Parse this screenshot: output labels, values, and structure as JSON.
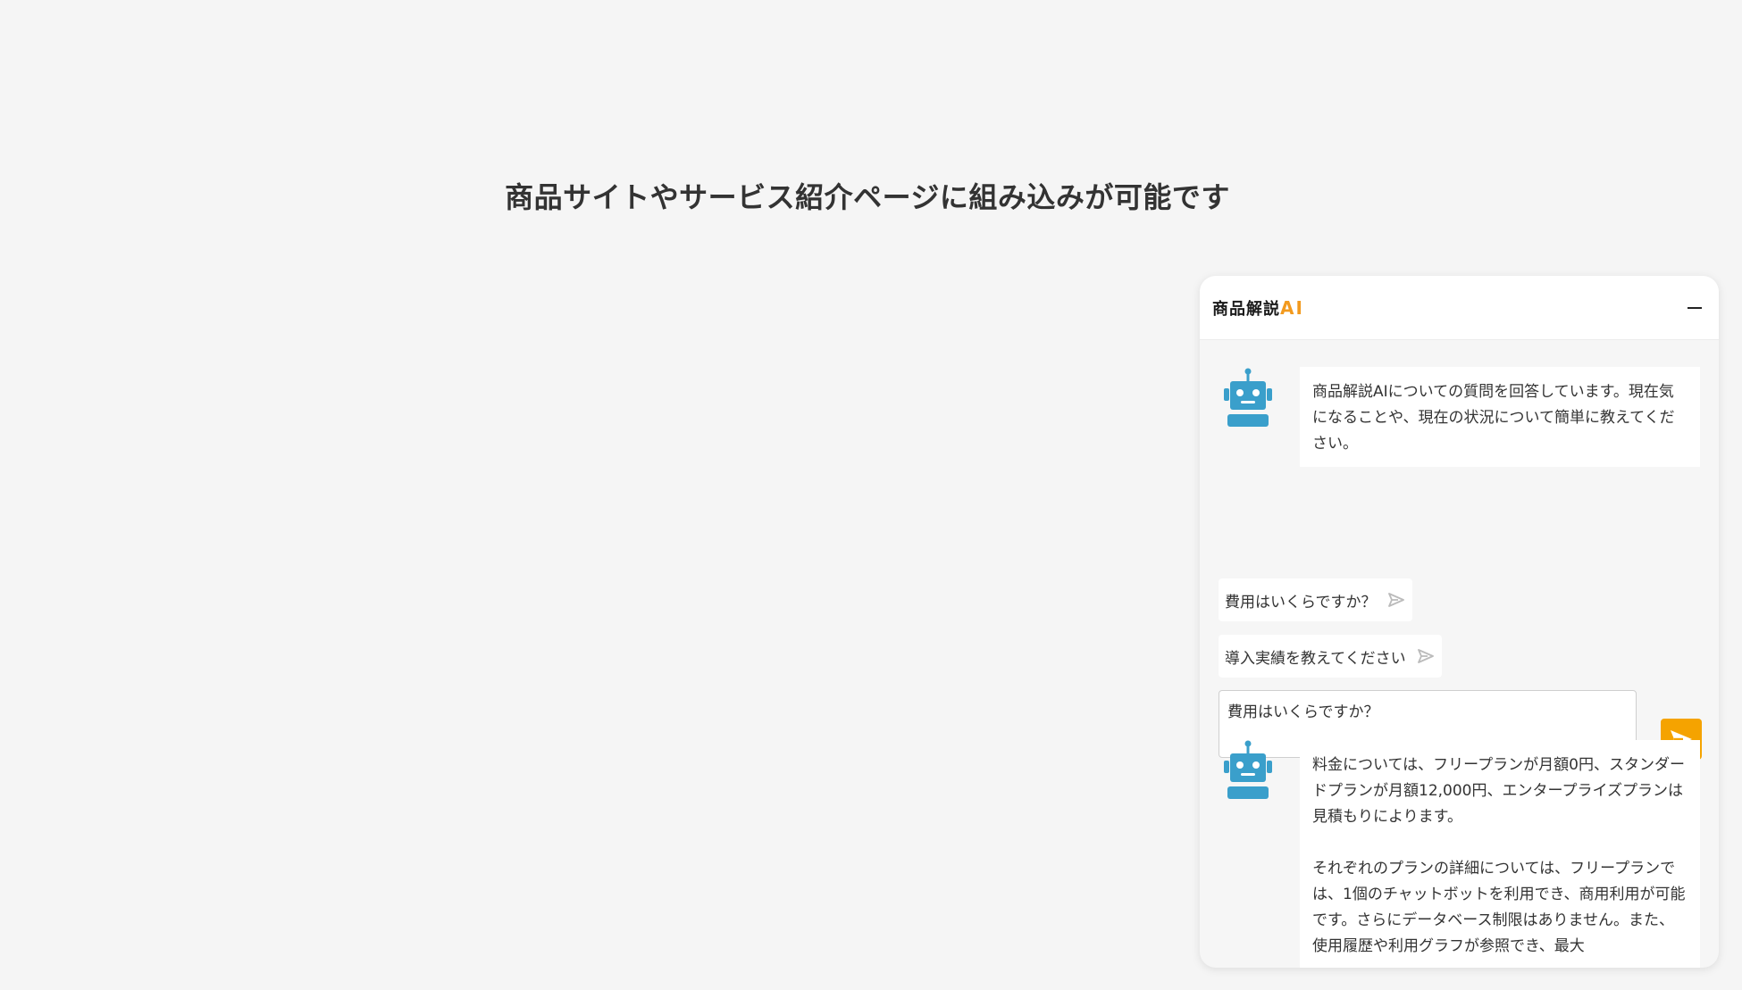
{
  "page": {
    "headline": "商品サイトやサービス紹介ページに組み込みが可能です"
  },
  "widget": {
    "title_main": "商品解説",
    "title_accent": "AI",
    "minimize_label": "−",
    "greeting": "商品解説AIについての質問を回答しています。現在気になることや、現在の状況について簡単に教えてください。",
    "suggestions": [
      "費用はいくらですか？",
      "導入実績を教えてください"
    ],
    "input_value": "費用はいくらですか？",
    "answer_paragraphs": [
      "料金については、フリープランが月額0円、スタンダードプランが月額12,000円、エンタープライズプランは見積もりによります。",
      "それぞれのプランの詳細については、フリープランでは、1個のチャットボットを利用でき、商用利用が可能です。さらにデータベース制限はありません。また、使用履歴や利用グラフが参照でき、最大"
    ],
    "colors": {
      "accent": "#f29a1f",
      "send_button": "#f5a300",
      "bot_avatar": "#3a9fcb"
    },
    "icons": {
      "avatar": "robot-icon",
      "send": "send-arrow-icon"
    }
  }
}
